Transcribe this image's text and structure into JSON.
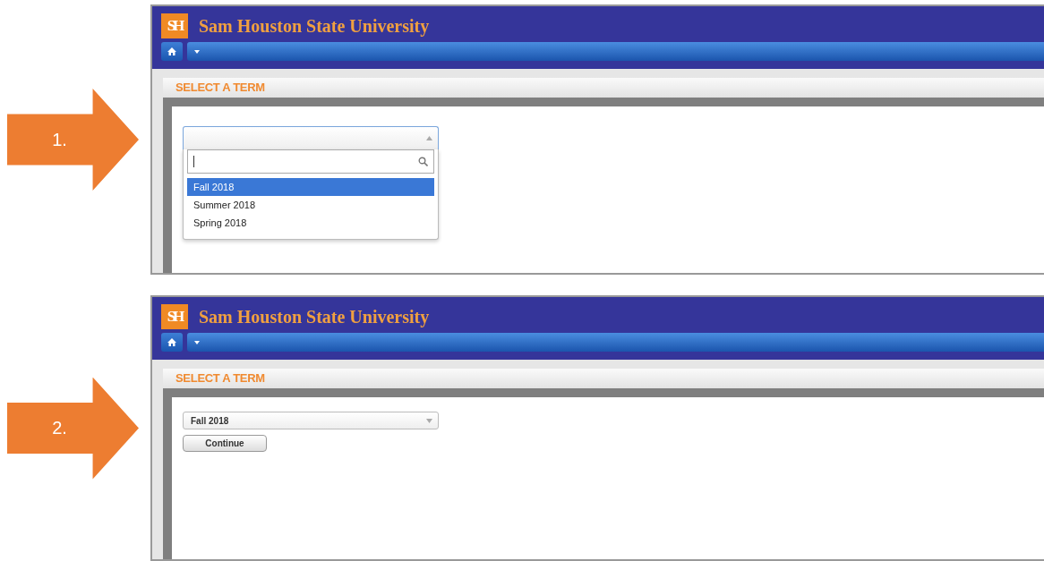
{
  "steps": [
    {
      "number": "1.",
      "screen": {
        "logo": "SH",
        "university": "Sam Houston State University",
        "heading": "SELECT A TERM",
        "dropdown": {
          "expanded": true,
          "options": [
            {
              "label": "Fall 2018",
              "selected": true
            },
            {
              "label": "Summer 2018",
              "selected": false
            },
            {
              "label": "Spring 2018",
              "selected": false
            }
          ]
        }
      }
    },
    {
      "number": "2.",
      "screen": {
        "logo": "SH",
        "university": "Sam Houston State University",
        "heading": "SELECT A TERM",
        "dropdown": {
          "expanded": false,
          "value": "Fall 2018"
        },
        "button": "Continue"
      }
    }
  ]
}
